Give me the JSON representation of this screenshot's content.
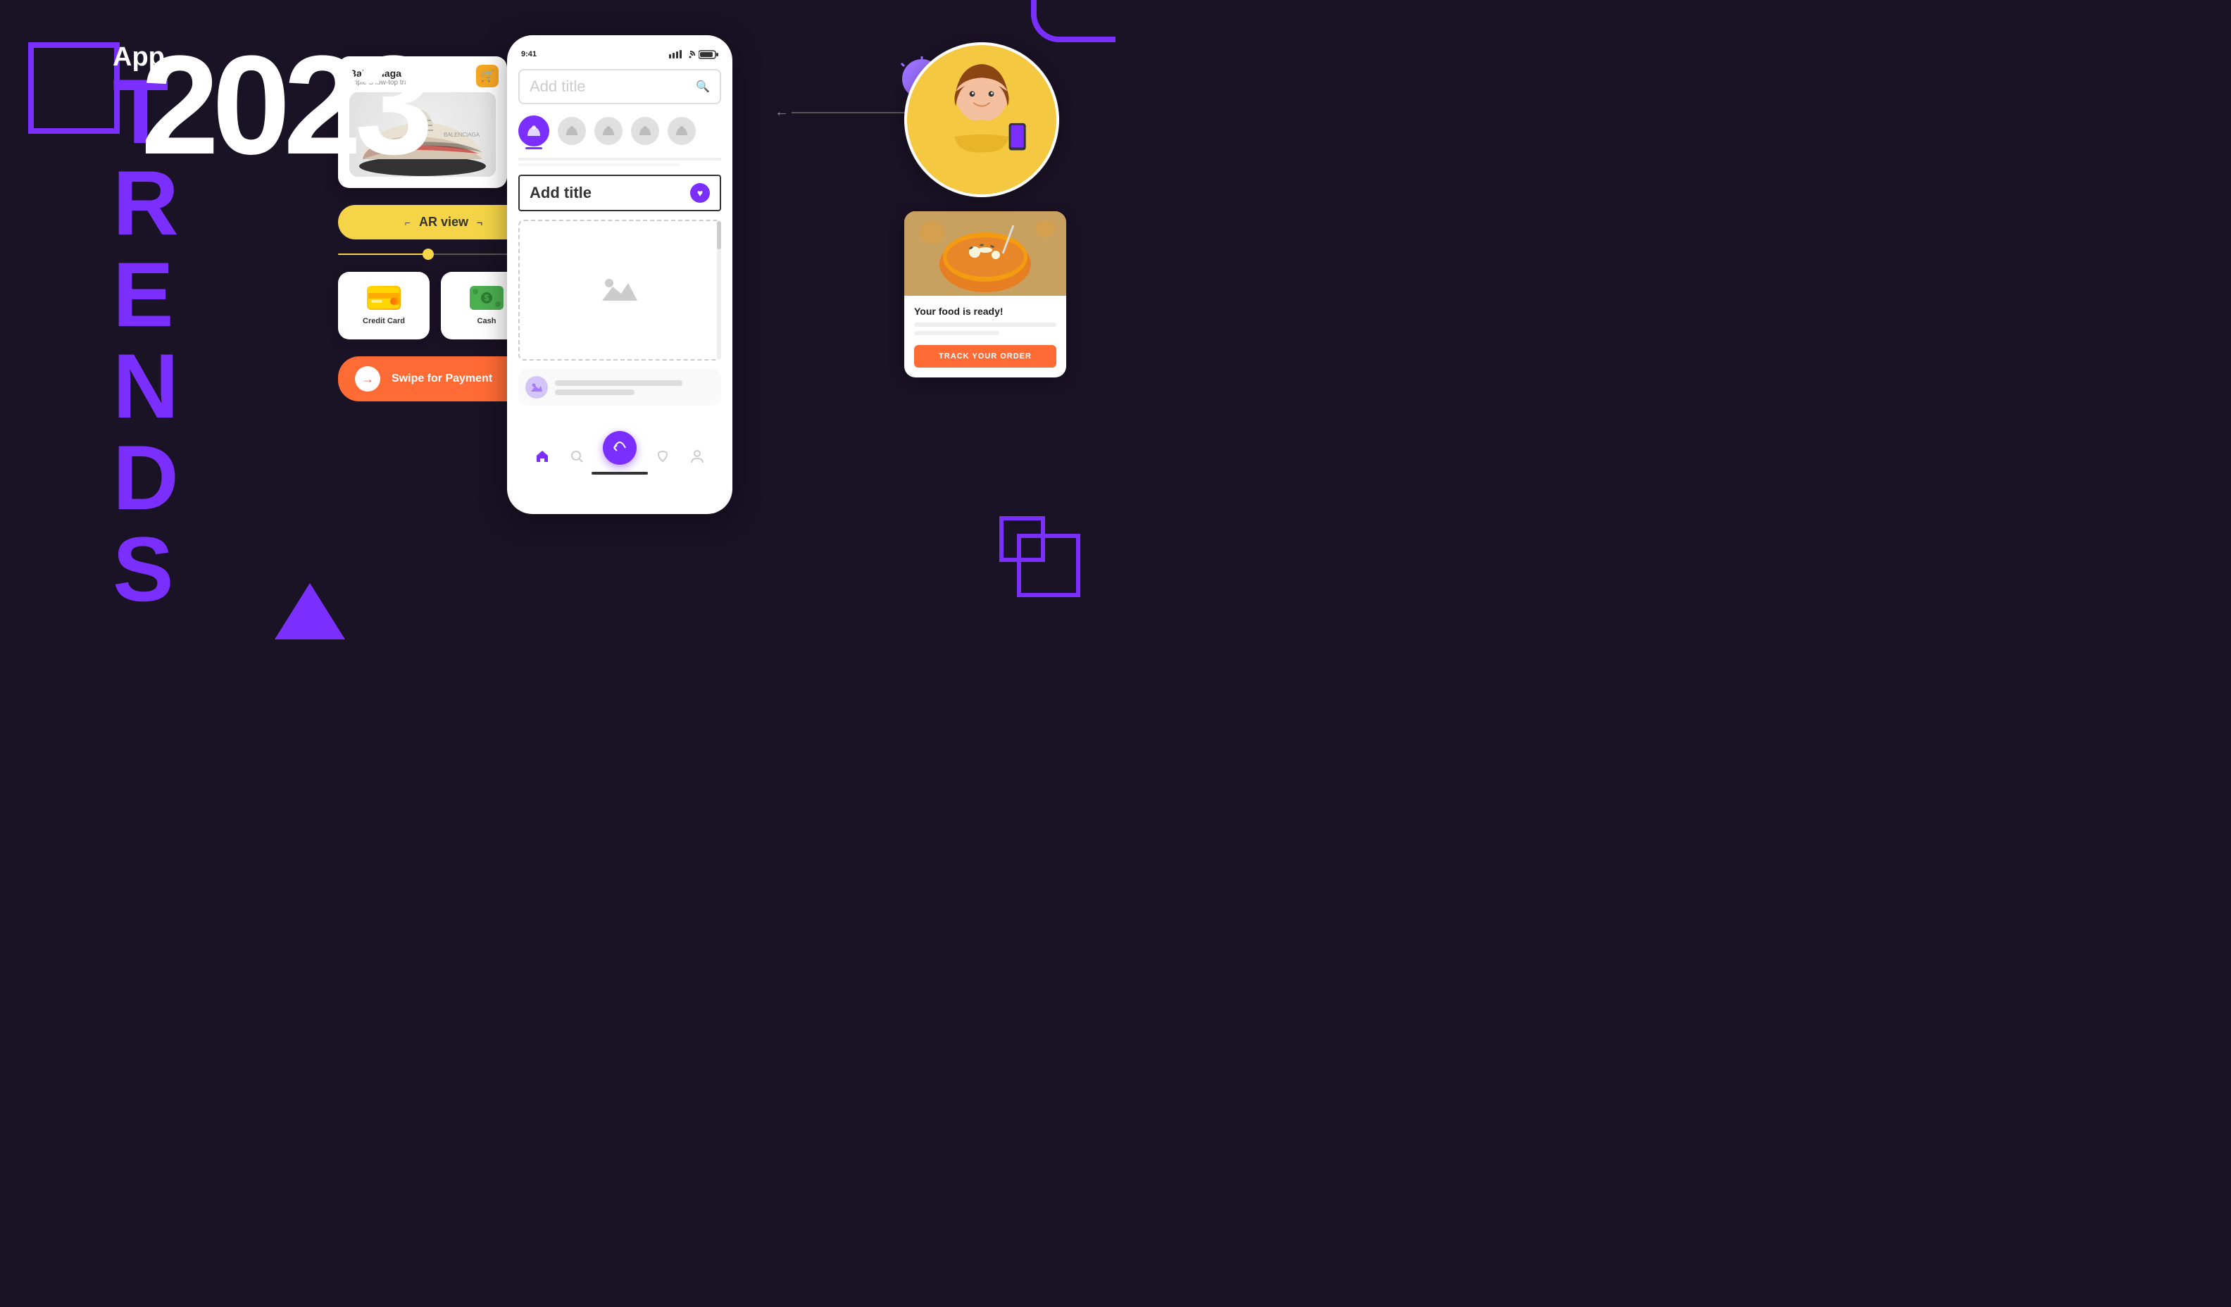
{
  "meta": {
    "title": "App Trends 2023"
  },
  "header": {
    "app_label": "App",
    "trends_letters": [
      "T",
      "R",
      "E",
      "N",
      "D",
      "S"
    ],
    "year": "2023"
  },
  "phone_status": {
    "time": "9:41",
    "signal": "▌▌▌",
    "wifi": "WiFi",
    "battery": "🔋"
  },
  "product": {
    "brand": "Balenciaga",
    "subtitle": "Triple S low-top trainers",
    "ar_btn": "AR view"
  },
  "payment": {
    "credit_card_label": "Credit Card",
    "cash_label": "Cash",
    "swipe_label": "Swipe for Payment"
  },
  "phone_ui": {
    "search_placeholder": "Add title",
    "title_placeholder": "Add title",
    "search_icon": "🔍"
  },
  "food_card": {
    "title": "Your food is ready!",
    "track_btn": "TRACK YOUR ORDER"
  },
  "colors": {
    "purple": "#7b2fff",
    "yellow": "#f5d547",
    "orange": "#ff6b35",
    "dark_bg": "#1a1225"
  }
}
